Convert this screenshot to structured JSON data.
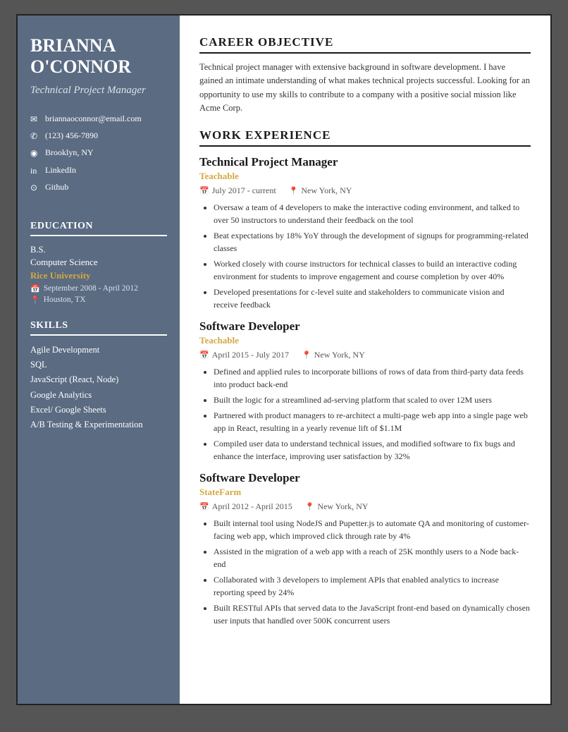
{
  "sidebar": {
    "name": "BRIANNA O'CONNOR",
    "title": "Technical Project Manager",
    "contact": [
      {
        "icon": "✉",
        "text": "briannaoconnor@email.com"
      },
      {
        "icon": "✆",
        "text": "(123) 456-7890"
      },
      {
        "icon": "◉",
        "text": "Brooklyn, NY"
      },
      {
        "icon": "in",
        "text": "LinkedIn"
      },
      {
        "icon": "⊙",
        "text": "Github"
      }
    ],
    "education_title": "EDUCATION",
    "education": {
      "degree": "B.S.",
      "major": "Computer Science",
      "school": "Rice University",
      "dates": "September 2008 - April 2012",
      "location": "Houston, TX"
    },
    "skills_title": "SKILLS",
    "skills": [
      "Agile Development",
      "SQL",
      "JavaScript (React, Node)",
      "Google Analytics",
      "Excel/ Google Sheets",
      "A/B Testing & Experimentation"
    ]
  },
  "main": {
    "career_objective_title": "CAREER OBJECTIVE",
    "career_objective": "Technical project manager with extensive background in software development. I have gained an intimate understanding of what makes technical projects successful. Looking for an opportunity to use my skills to contribute to a company with a positive social mission like Acme Corp.",
    "work_experience_title": "WORK EXPERIENCE",
    "jobs": [
      {
        "title": "Technical Project Manager",
        "company": "Teachable",
        "dates": "July 2017 - current",
        "location": "New York, NY",
        "bullets": [
          "Oversaw a team of 4 developers to make the interactive coding environment, and talked to over 50 instructors to understand their feedback on the tool",
          "Beat expectations by 18% YoY through the development of signups for programming-related classes",
          "Worked closely with course instructors for technical classes to build an interactive coding environment for students to improve engagement and course completion by over 40%",
          "Developed presentations for c-level suite and stakeholders to communicate vision and receive feedback"
        ]
      },
      {
        "title": "Software Developer",
        "company": "Teachable",
        "dates": "April 2015 - July 2017",
        "location": "New York, NY",
        "bullets": [
          "Defined and applied rules to incorporate billions of rows of data from third-party data feeds into product back-end",
          "Built the logic for a streamlined ad-serving platform that scaled to over 12M users",
          "Partnered with product managers to re-architect a multi-page web app into a single page web app in React, resulting in a yearly revenue lift of $1.1M",
          "Compiled user data to understand technical issues, and modified software to fix bugs and enhance the interface, improving user satisfaction by 32%"
        ]
      },
      {
        "title": "Software Developer",
        "company": "StateFarm",
        "dates": "April 2012 - April 2015",
        "location": "New York, NY",
        "bullets": [
          "Built internal tool using NodeJS and Pupetter.js to automate QA and monitoring of customer-facing web app, which improved click through rate by 4%",
          "Assisted in the migration of a web app with a reach of 25K monthly users to a Node back-end",
          "Collaborated with 3 developers to implement APIs that enabled analytics to increase reporting speed by 24%",
          "Built RESTful APIs that served data to the JavaScript front-end based on dynamically chosen user inputs that handled over 500K concurrent users"
        ]
      }
    ]
  }
}
